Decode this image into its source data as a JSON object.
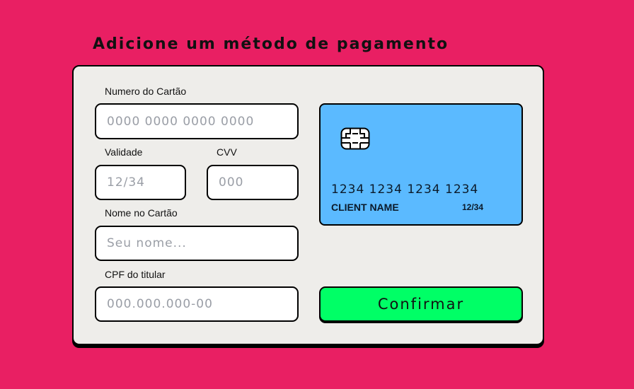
{
  "page": {
    "title": "Adicione um método de pagamento",
    "background_color": "#E91F63"
  },
  "form": {
    "card_number": {
      "label": "Numero do Cartão",
      "placeholder": "0000 0000 0000 0000",
      "value": ""
    },
    "expiry": {
      "label": "Validade",
      "placeholder": "12/34",
      "value": ""
    },
    "cvv": {
      "label": "CVV",
      "placeholder": "000",
      "value": ""
    },
    "name": {
      "label": "Nome no Cartão",
      "placeholder": "Seu nome...",
      "value": ""
    },
    "cpf": {
      "label": "CPF do titular",
      "placeholder": "000.000.000-00",
      "value": ""
    },
    "confirm_label": "Confirmar",
    "confirm_color": "#00FF66"
  },
  "card_preview": {
    "number": "1234 1234 1234 1234",
    "name": "CLIENT NAME",
    "expiry": "12/34",
    "color": "#5BBAFF",
    "chip_icon": "chip-icon"
  }
}
